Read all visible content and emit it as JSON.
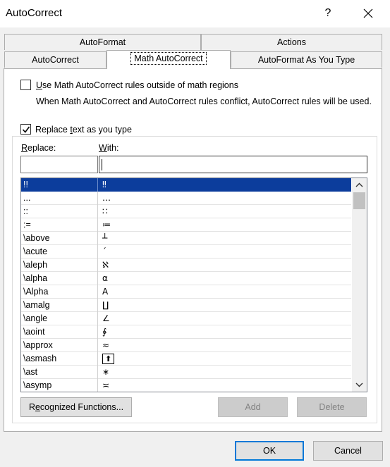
{
  "window": {
    "title": "AutoCorrect",
    "help_label": "?"
  },
  "tabs": {
    "row1": [
      "AutoFormat",
      "Actions"
    ],
    "row2": [
      "AutoCorrect",
      "Math AutoCorrect",
      "AutoFormat As You Type"
    ],
    "active": "Math AutoCorrect"
  },
  "options": {
    "use_outside": {
      "label_prefix": "",
      "label_underlined": "U",
      "label_rest": "se Math AutoCorrect rules outside of math regions",
      "checked": false
    },
    "conflict_note": "When Math AutoCorrect and AutoCorrect rules conflict, AutoCorrect rules will be used.",
    "replace_as_type": {
      "label_prefix": "Replace ",
      "label_underlined": "t",
      "label_rest": "ext as you type",
      "checked": true
    }
  },
  "columns": {
    "replace_underlined": "R",
    "replace_rest": "eplace:",
    "with_underlined": "W",
    "with_rest": "ith:"
  },
  "fields": {
    "replace_value": "",
    "with_value": ""
  },
  "entries": [
    {
      "replace": "!!",
      "with": "‼",
      "selected": true
    },
    {
      "replace": "...",
      "with": "…"
    },
    {
      "replace": "::",
      "with": "∷"
    },
    {
      "replace": ":=",
      "with": "≔"
    },
    {
      "replace": "\\above",
      "with": "┴"
    },
    {
      "replace": "\\acute",
      "with": "´"
    },
    {
      "replace": "\\aleph",
      "with": "ℵ"
    },
    {
      "replace": "\\alpha",
      "with": "α"
    },
    {
      "replace": "\\Alpha",
      "with": "A"
    },
    {
      "replace": "\\amalg",
      "with": "∐"
    },
    {
      "replace": "\\angle",
      "with": "∠"
    },
    {
      "replace": "\\aoint",
      "with": "∳"
    },
    {
      "replace": "\\approx",
      "with": "≈"
    },
    {
      "replace": "\\asmash",
      "with": "⬆",
      "boxed": true
    },
    {
      "replace": "\\ast",
      "with": "∗"
    },
    {
      "replace": "\\asymp",
      "with": "≍"
    }
  ],
  "buttons": {
    "recognized_underlined": "e",
    "recognized_prefix": "R",
    "recognized_rest": "cognized Functions...",
    "add": "Add",
    "delete": "Delete",
    "ok": "OK",
    "cancel": "Cancel"
  },
  "colors": {
    "selection": "#0c3d9c",
    "default_button_border": "#0078d7"
  }
}
